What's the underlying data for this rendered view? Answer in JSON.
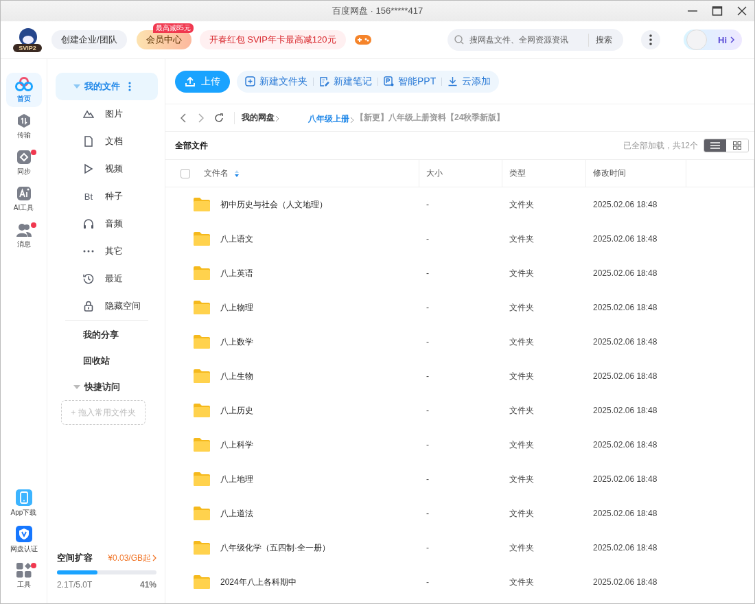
{
  "window": {
    "title": "百度网盘 · 156*****417"
  },
  "header": {
    "logo_badge": "SVIP2",
    "team_button": "创建企业/团队",
    "vip": {
      "label": "会员中心",
      "badge": "最高减85元"
    },
    "promo": "开春红包 SVIP年卡最高减120元",
    "search": {
      "placeholder": "搜网盘文件、全网资源资讯",
      "button": "搜索"
    },
    "greeting": "Hi"
  },
  "rail": {
    "top": [
      {
        "label": "首页",
        "selected": true,
        "dot": false
      },
      {
        "label": "传输",
        "selected": false,
        "dot": false
      },
      {
        "label": "同步",
        "selected": false,
        "dot": true
      },
      {
        "label": "AI工具",
        "selected": false,
        "dot": false
      },
      {
        "label": "消息",
        "selected": false,
        "dot": true
      }
    ],
    "bottom": [
      {
        "label": "App下载",
        "dot": false
      },
      {
        "label": "网盘认证",
        "dot": false
      },
      {
        "label": "工具",
        "dot": true
      }
    ]
  },
  "nav": {
    "my_files": {
      "label": "我的文件",
      "selected": true
    },
    "categories": [
      {
        "label": "图片"
      },
      {
        "label": "文档"
      },
      {
        "label": "视频"
      },
      {
        "label": "种子",
        "icon_text": "Bt"
      },
      {
        "label": "音频"
      },
      {
        "label": "其它"
      },
      {
        "label": "最近"
      },
      {
        "label": "隐藏空间"
      }
    ],
    "links": [
      "我的分享",
      "回收站"
    ],
    "quick_access": "快捷访问",
    "drop_hint": "+ 拖入常用文件夹",
    "storage": {
      "title": "空间扩容",
      "price": "¥0.03/GB起",
      "level": 0.41,
      "used": "2.1T/5.0T",
      "percent": "41%"
    }
  },
  "toolbar": {
    "upload": "上传",
    "actions": [
      "新建文件夹",
      "新建笔记",
      "智能PPT",
      "云添加"
    ]
  },
  "breadcrumb": [
    {
      "label": "我的网盘",
      "kind": "root"
    },
    {
      "label": "八年级上册",
      "kind": "link"
    },
    {
      "label": "【新更】八年级上册资料【24秋季新版】",
      "kind": "current"
    }
  ],
  "list": {
    "title": "全部文件",
    "status": "已全部加载，共12个",
    "view_modes": [
      {
        "kind": "list",
        "selected": true
      },
      {
        "kind": "grid",
        "selected": false
      }
    ]
  },
  "table": {
    "select_all_checked": false,
    "columns": [
      "文件名",
      "大小",
      "类型",
      "修改时间"
    ],
    "rows": [
      {
        "name": "初中历史与社会（人文地理）",
        "size": "-",
        "type": "文件夹",
        "modified": "2025.02.06 18:48"
      },
      {
        "name": "八上语文",
        "size": "-",
        "type": "文件夹",
        "modified": "2025.02.06 18:48"
      },
      {
        "name": "八上英语",
        "size": "-",
        "type": "文件夹",
        "modified": "2025.02.06 18:48"
      },
      {
        "name": "八上物理",
        "size": "-",
        "type": "文件夹",
        "modified": "2025.02.06 18:48"
      },
      {
        "name": "八上数学",
        "size": "-",
        "type": "文件夹",
        "modified": "2025.02.06 18:48"
      },
      {
        "name": "八上生物",
        "size": "-",
        "type": "文件夹",
        "modified": "2025.02.06 18:48"
      },
      {
        "name": "八上历史",
        "size": "-",
        "type": "文件夹",
        "modified": "2025.02.06 18:48"
      },
      {
        "name": "八上科学",
        "size": "-",
        "type": "文件夹",
        "modified": "2025.02.06 18:48"
      },
      {
        "name": "八上地理",
        "size": "-",
        "type": "文件夹",
        "modified": "2025.02.06 18:48"
      },
      {
        "name": "八上道法",
        "size": "-",
        "type": "文件夹",
        "modified": "2025.02.06 18:48"
      },
      {
        "name": "八年级化学（五四制·全一册）",
        "size": "-",
        "type": "文件夹",
        "modified": "2025.02.06 18:48"
      },
      {
        "name": "2024年八上各科期中",
        "size": "-",
        "type": "文件夹",
        "modified": "2025.02.06 18:48"
      }
    ]
  }
}
